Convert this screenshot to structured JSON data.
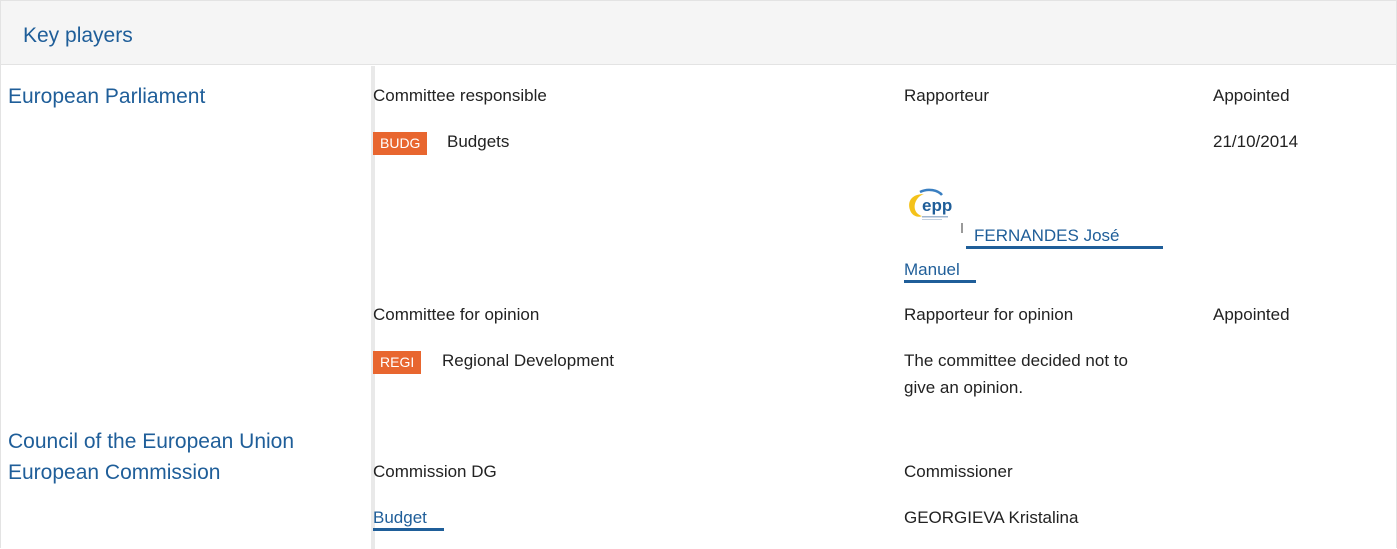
{
  "header": {
    "title": "Key players"
  },
  "institutions": {
    "ep": "European Parliament",
    "council": "Council of the European Union",
    "commission": "European Commission"
  },
  "ep_responsible": {
    "col_committee": "Committee responsible",
    "col_rapporteur": "Rapporteur",
    "col_appointed": "Appointed",
    "badge": "BUDG",
    "committee": "Budgets",
    "date": "21/10/2014",
    "rapporteur_group_logo": "epp",
    "rapporteur_name_line1": "FERNANDES José",
    "rapporteur_name_line2": "Manuel"
  },
  "ep_opinion": {
    "col_committee": "Committee for opinion",
    "col_rapporteur": "Rapporteur for opinion",
    "col_appointed": "Appointed",
    "badge": "REGI",
    "committee": "Regional Development",
    "note_line1": "The committee decided not to",
    "note_line2": "give an opinion."
  },
  "commission": {
    "col_dg": "Commission DG",
    "col_commissioner": "Commissioner",
    "dg": "Budget",
    "commissioner": "GEORGIEVA Kristalina"
  },
  "colors": {
    "link": "#1f5e99",
    "badge": "#e8662f",
    "header_bg": "#f5f5f5"
  }
}
